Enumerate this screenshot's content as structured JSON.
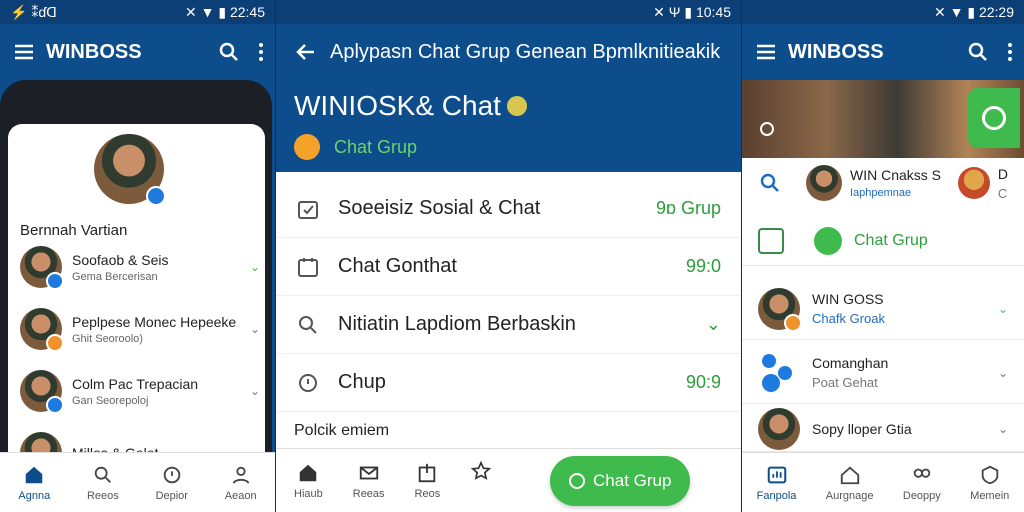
{
  "left": {
    "status_left": "⚡ ⁑ɗᗡ",
    "status_right": "✕ ▼ ▮ 22:45",
    "app_title": "WINBOSS",
    "profile_name": "Bernnah Vartian",
    "contacts": [
      {
        "name": "Soofaob & Seis",
        "sub": "Gema Bercerisan",
        "badge_color": "#1f7ae0"
      },
      {
        "name": "Peplpese Monec Hepeeke",
        "sub": "Ghit Seoroolo)",
        "badge_color": "#f0922a"
      },
      {
        "name": "Colm Pac Trepacian",
        "sub": "Gan Seorepoloj",
        "badge_color": "#1f7ae0"
      },
      {
        "name": "Millos & Gelot",
        "sub": "",
        "badge_color": "#f0922a"
      }
    ],
    "nav": [
      "Agnna",
      "Reeos",
      "Depior",
      "Aeaon"
    ]
  },
  "mid": {
    "status_right": "✕ Ψ ▮ 10:45",
    "header_title": "Aplypasn Chat Grup Genean Bpmlknitieakik",
    "big_title": "WINIOSK& Chat",
    "chat_grup": "Chat Grup",
    "rows": [
      {
        "label": "Soeeisiz Sosial & Chat",
        "value": "9ɒ Grup"
      },
      {
        "label": "Chat Gonthat",
        "value": "99:0"
      },
      {
        "label": "Nitiatin Lapdiom Berbaskin",
        "value": "⌄"
      },
      {
        "label": "Chup",
        "value": "90:9"
      }
    ],
    "cut_text": "Polcik emiem",
    "nav": [
      "Hiaub",
      "Reeas",
      "Reos"
    ],
    "pill_label": "Chat Grup"
  },
  "right": {
    "status_right": "✕ ▼ ▮ 22:29",
    "app_title": "WINBOSS",
    "top_name": "WIN Cnakss S",
    "top_sub": "Iaphpemnae",
    "top_d": "D",
    "top_c": "C",
    "chat_grup": "Chat Grup",
    "items": [
      {
        "name": "WIN GOSS",
        "sub": "Chafk Groak"
      },
      {
        "name": "Comanghan",
        "sub": "Poat Gehat"
      },
      {
        "name": "Sopy lloper Gtia",
        "sub": ""
      }
    ],
    "nav": [
      "Fanpola",
      "Aurgnage",
      "Deoppy",
      "Memein"
    ]
  },
  "colors": {
    "primary": "#0d4d8c",
    "accent_green": "#3fba4d",
    "blue_link": "#1f6cc0"
  }
}
